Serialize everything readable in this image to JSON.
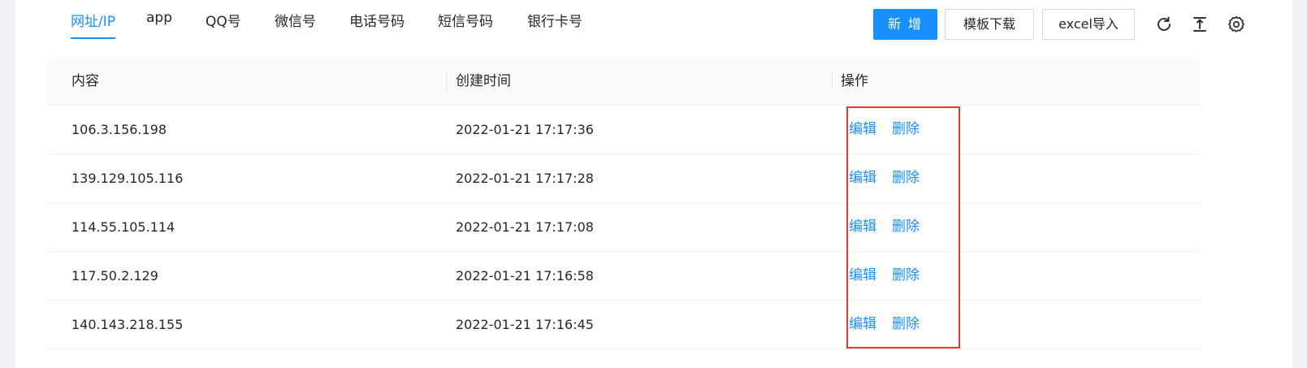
{
  "tabs": [
    {
      "label": "网址/IP",
      "active": true
    },
    {
      "label": "app",
      "active": false
    },
    {
      "label": "QQ号",
      "active": false
    },
    {
      "label": "微信号",
      "active": false
    },
    {
      "label": "电话号码",
      "active": false
    },
    {
      "label": "短信号码",
      "active": false
    },
    {
      "label": "银行卡号",
      "active": false
    }
  ],
  "toolbar": {
    "add_label": "新 增",
    "template_download_label": "模板下载",
    "excel_import_label": "excel导入",
    "icons": [
      "reload-icon",
      "column-height-icon",
      "setting-icon"
    ]
  },
  "table": {
    "columns": [
      "内容",
      "创建时间",
      "操作"
    ],
    "rows": [
      {
        "content": "106.3.156.198",
        "created": "2022-01-21 17:17:36"
      },
      {
        "content": "139.129.105.116",
        "created": "2022-01-21 17:17:28"
      },
      {
        "content": "114.55.105.114",
        "created": "2022-01-21 17:17:08"
      },
      {
        "content": "117.50.2.129",
        "created": "2022-01-21 17:16:58"
      },
      {
        "content": "140.143.218.155",
        "created": "2022-01-21 17:16:45"
      }
    ],
    "actions": {
      "edit": "编辑",
      "delete": "删除"
    }
  },
  "colors": {
    "primary": "#1890ff",
    "highlight": "#e53935",
    "header_bg": "#fafafa",
    "page_bg": "#f0f2f5"
  }
}
